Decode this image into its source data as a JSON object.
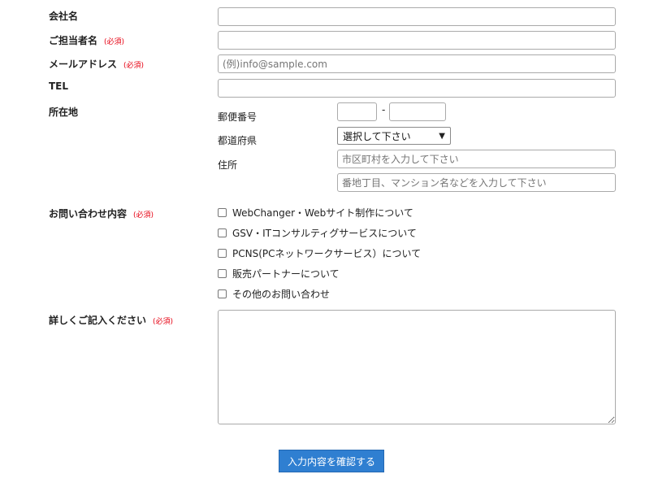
{
  "fields": {
    "company": {
      "label": "会社名",
      "value": ""
    },
    "contact_person": {
      "label": "ご担当者名",
      "required": "(必須)",
      "value": ""
    },
    "email": {
      "label": "メールアドレス",
      "required": "(必須)",
      "placeholder": "(例)info@sample.com",
      "value": ""
    },
    "tel": {
      "label": "TEL",
      "value": ""
    },
    "address": {
      "label": "所在地",
      "postal_label": "郵便番号",
      "postal_dash": "-",
      "prefecture_label": "都道府県",
      "prefecture_selected": "選択して下さい",
      "street_label": "住所",
      "city_placeholder": "市区町村を入力して下さい",
      "building_placeholder": "番地丁目、マンション名などを入力して下さい"
    },
    "inquiry": {
      "label": "お問い合わせ内容",
      "required": "(必須)",
      "options": [
        {
          "label": "WebChanger・Webサイト制作について",
          "checked": false
        },
        {
          "label": "GSV・ITコンサルティグサービスについて",
          "checked": false
        },
        {
          "label": "PCNS(PCネットワークサービス）について",
          "checked": false
        },
        {
          "label": "販売パートナーについて",
          "checked": false
        },
        {
          "label": "その他のお問い合わせ",
          "checked": false
        }
      ]
    },
    "details": {
      "label": "詳しくご記入ください",
      "required": "(必須)",
      "value": ""
    }
  },
  "submit_label": "入力内容を確認する",
  "colors": {
    "accent": "#2f7fd1",
    "required": "#e60012"
  },
  "icons": {
    "select": "chevron-down-icon"
  }
}
